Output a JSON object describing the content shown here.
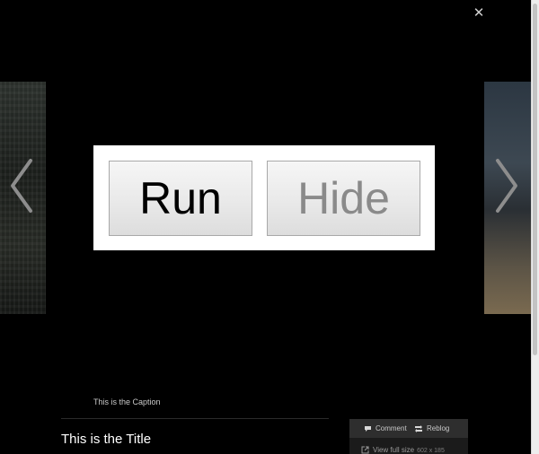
{
  "lightbox": {
    "close_glyph": "✕"
  },
  "dialog": {
    "run_label": "Run",
    "hide_label": "Hide"
  },
  "post": {
    "caption": "This is the Caption",
    "title": "This is the Title"
  },
  "actions": {
    "comment_label": "Comment",
    "reblog_label": "Reblog",
    "view_full_size_label": "View full size",
    "full_size_dims": "602 x 185"
  },
  "icons": {
    "close": "close-icon",
    "prev": "chevron-left-icon",
    "next": "chevron-right-icon",
    "comment": "comment-icon",
    "reblog": "reblog-icon",
    "external": "external-link-icon"
  },
  "colors": {
    "background": "#000000",
    "panel": "#ffffff",
    "run_text": "#000000",
    "hide_text": "#8a8a8a",
    "action_bar": "#2e2e2e"
  }
}
